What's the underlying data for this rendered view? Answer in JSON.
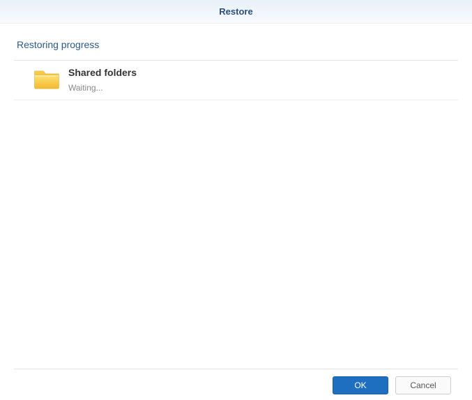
{
  "title": "Restore",
  "section_header": "Restoring progress",
  "items": [
    {
      "label": "Shared folders",
      "status": "Waiting..."
    }
  ],
  "buttons": {
    "ok": "OK",
    "cancel": "Cancel"
  }
}
